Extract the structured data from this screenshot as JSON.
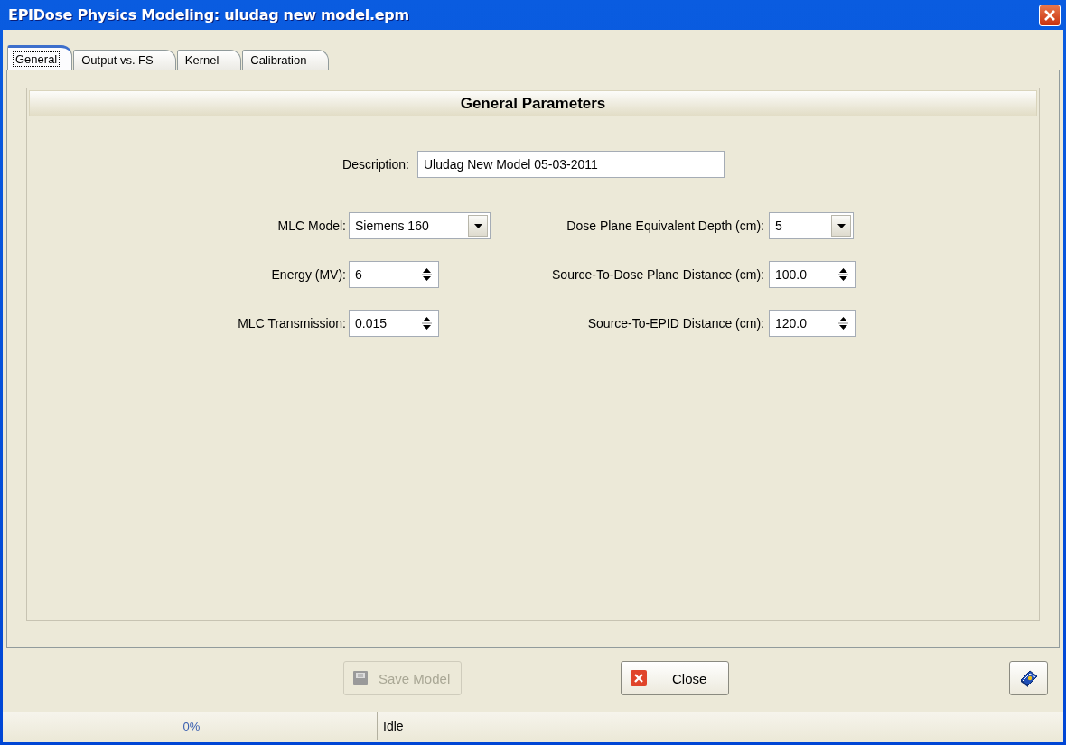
{
  "window": {
    "title": "EPIDose Physics Modeling: uludag new model.epm"
  },
  "tabs": [
    {
      "label": "General",
      "selected": true
    },
    {
      "label": "Output vs. FS",
      "selected": false
    },
    {
      "label": "Kernel",
      "selected": false
    },
    {
      "label": "Calibration",
      "selected": false
    }
  ],
  "group": {
    "title": "General Parameters",
    "description": {
      "label": "Description:",
      "value": "Uludag New Model 05-03-2011"
    },
    "left_fields": [
      {
        "label": "MLC Model:",
        "value": "Siemens 160",
        "kind": "combo"
      },
      {
        "label": "Energy (MV):",
        "value": "6",
        "kind": "spin"
      },
      {
        "label": "MLC Transmission:",
        "value": "0.015",
        "kind": "spin"
      }
    ],
    "right_fields": [
      {
        "label": "Dose Plane Equivalent Depth (cm):",
        "value": "5",
        "kind": "combo"
      },
      {
        "label": "Source-To-Dose Plane Distance (cm):",
        "value": "100.0",
        "kind": "spin"
      },
      {
        "label": "Source-To-EPID Distance (cm):",
        "value": "120.0",
        "kind": "spin"
      }
    ]
  },
  "buttons": [
    {
      "label": "Save Model",
      "disabled": true
    },
    {
      "label": "Close",
      "disabled": false
    }
  ],
  "status_bar": {
    "progress": {
      "text": "0%"
    },
    "message": "Idle"
  }
}
